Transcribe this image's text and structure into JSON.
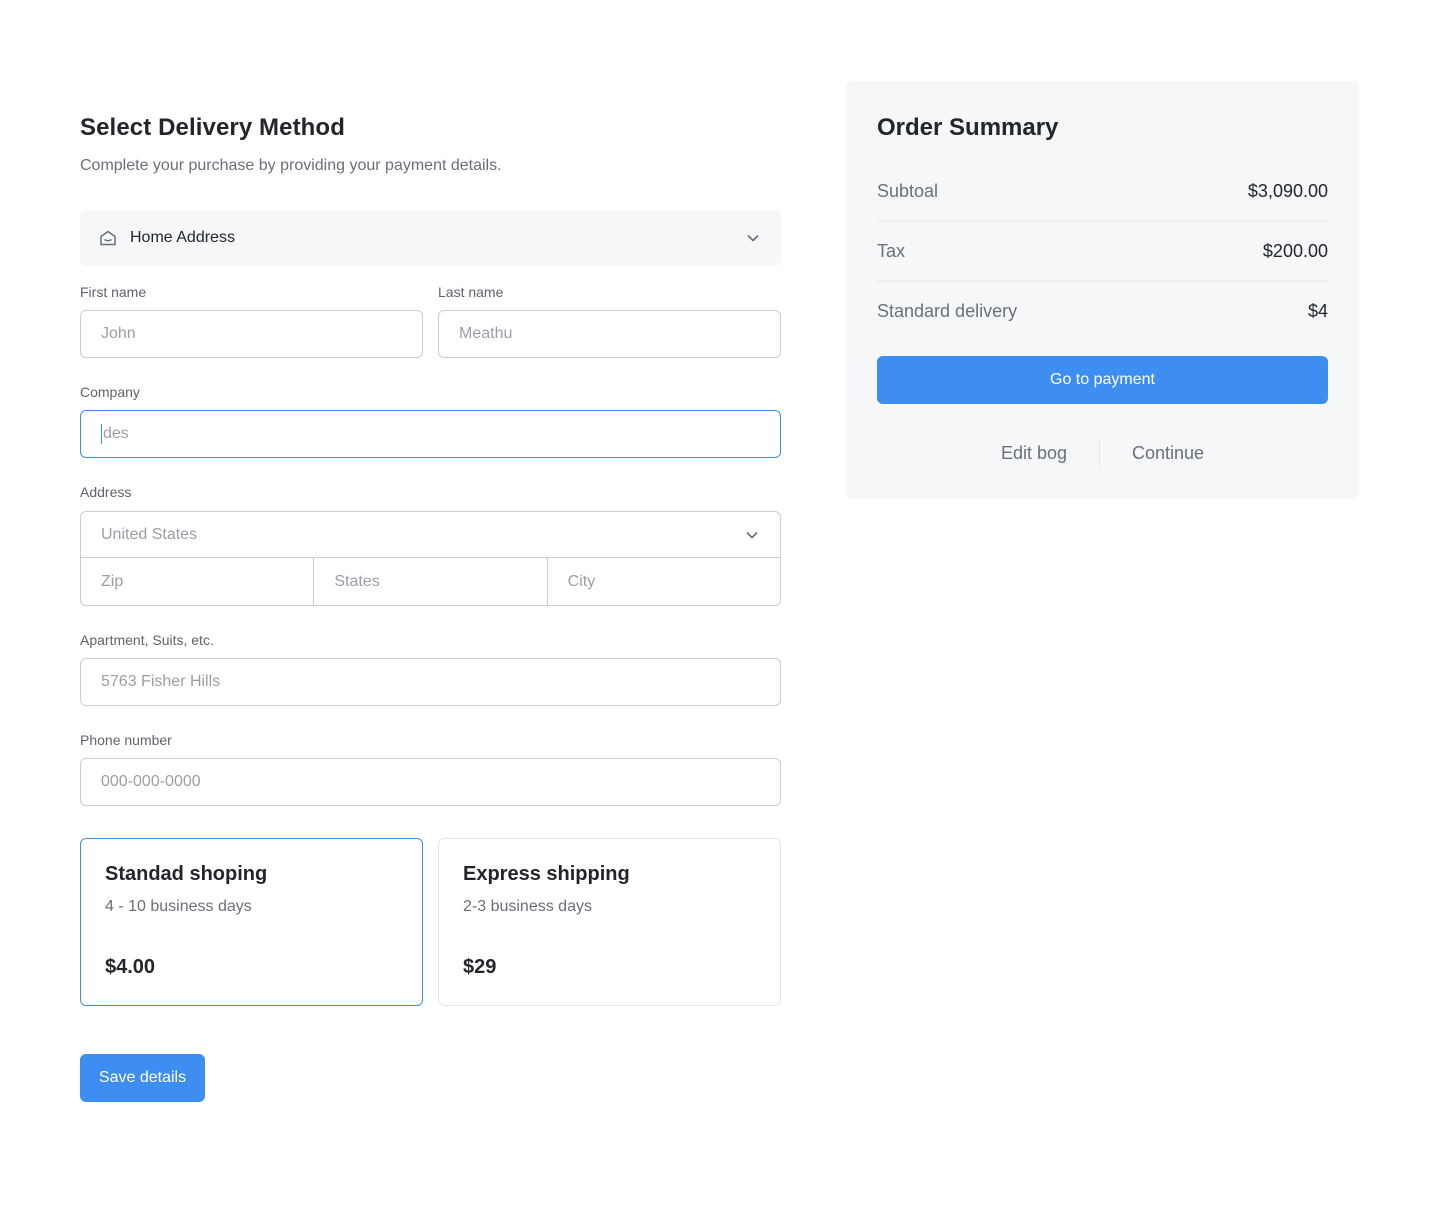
{
  "delivery": {
    "title": "Select Delivery Method",
    "subtitle": "Complete your purchase by providing your payment details.",
    "address_type": "Home Address",
    "fields": {
      "first_name_label": "First name",
      "first_name_placeholder": "John",
      "last_name_label": "Last name",
      "last_name_placeholder": "Meathu",
      "company_label": "Company",
      "company_value": "des",
      "address_label": "Address",
      "country_value": "United States",
      "zip_placeholder": "Zip",
      "state_placeholder": "States",
      "city_placeholder": "City",
      "apartment_label": "Apartment, Suits, etc.",
      "apartment_placeholder": "5763 Fisher Hills",
      "phone_label": "Phone number",
      "phone_placeholder": "000-000-0000"
    },
    "shipping_options": [
      {
        "name": "Standad shoping",
        "days": "4 - 10 business days",
        "price": "$4.00",
        "selected": true
      },
      {
        "name": "Express shipping",
        "days": "2-3 business days",
        "price": "$29",
        "selected": false
      }
    ],
    "save_label": "Save details"
  },
  "summary": {
    "title": "Order Summary",
    "rows": [
      {
        "label": "Subtoal",
        "value": "$3,090.00"
      },
      {
        "label": "Tax",
        "value": "$200.00"
      },
      {
        "label": "Standard delivery",
        "value": "$4"
      }
    ],
    "pay_label": "Go to payment",
    "links": [
      "Edit bog",
      "Continue"
    ]
  },
  "colors": {
    "accent": "#3d8ef0",
    "panel_bg": "#f6f7f9",
    "border": "#c9cdd2",
    "text_primary": "#22262b",
    "text_muted": "#6b7078"
  },
  "icons": {
    "address_select": "home-icon",
    "dropdown": "chevron-down-icon"
  }
}
